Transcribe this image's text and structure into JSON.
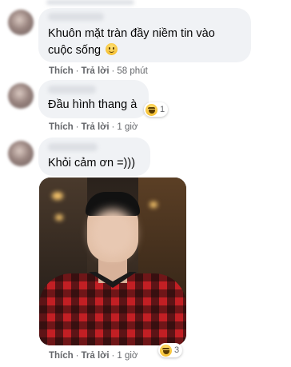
{
  "comments": [
    {
      "text_lines": [
        "Khuôn mặt tràn đầy niềm tin vào",
        "cuộc sống"
      ],
      "emoji": "smiling-face-icon"
    },
    {
      "text": "Đầu hình thang à",
      "actions": {
        "like": "Thích",
        "reply": "Trả lời",
        "time": "58 phút"
      },
      "reaction": {
        "icon": "haha-icon",
        "count": "1"
      }
    },
    {
      "text": "Khỏi cảm ơn =)))",
      "actions": {
        "like": "Thích",
        "reply": "Trả lời",
        "time": "1 giờ"
      }
    },
    {
      "image": "boy-portrait-photo",
      "actions": {
        "like": "Thích",
        "reply": "Trả lời",
        "time": "1 giờ"
      },
      "reaction": {
        "icon": "haha-icon",
        "count": "3"
      }
    }
  ],
  "colors": {
    "bubble": "#f0f2f5",
    "meta": "#65676b",
    "text": "#050505"
  }
}
